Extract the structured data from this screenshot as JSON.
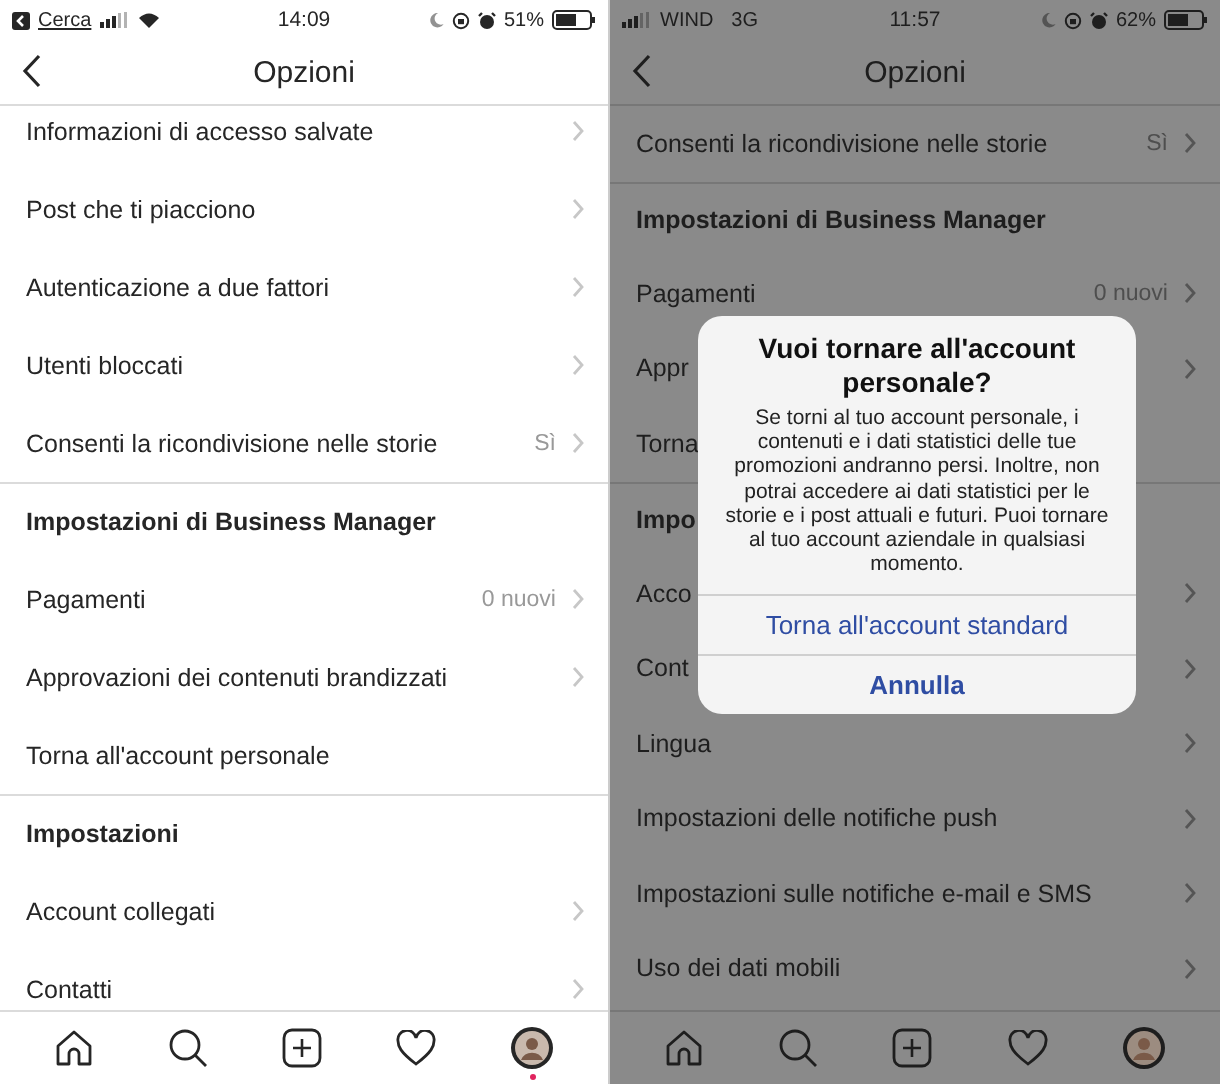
{
  "screens": [
    {
      "dimmed": false,
      "status_bar": {
        "back_link": "Cerca",
        "time": "14:09",
        "battery_text": "51%"
      },
      "nav": {
        "title": "Opzioni"
      },
      "rows": [
        {
          "kind": "item",
          "label": "Informazioni di accesso salvate",
          "chevron": true
        },
        {
          "kind": "item",
          "label": "Post che ti piacciono",
          "chevron": true
        },
        {
          "kind": "item",
          "label": "Autenticazione a due fattori",
          "chevron": true
        },
        {
          "kind": "item",
          "label": "Utenti bloccati",
          "chevron": true
        },
        {
          "kind": "item",
          "label": "Consenti la ricondivisione nelle storie",
          "value": "Sì",
          "chevron": true
        },
        {
          "kind": "header",
          "label": "Impostazioni di Business Manager"
        },
        {
          "kind": "item",
          "label": "Pagamenti",
          "value": "0 nuovi",
          "chevron": true
        },
        {
          "kind": "item",
          "label": "Approvazioni dei contenuti brandizzati",
          "chevron": true
        },
        {
          "kind": "item",
          "label": "Torna all'account personale",
          "chevron": false
        },
        {
          "kind": "header",
          "label": "Impostazioni"
        },
        {
          "kind": "item",
          "label": "Account collegati",
          "chevron": true
        },
        {
          "kind": "item",
          "label": "Contatti",
          "chevron": true
        }
      ],
      "tab_bar": {
        "items": [
          {
            "kind": "home"
          },
          {
            "kind": "search"
          },
          {
            "kind": "add"
          },
          {
            "kind": "heart"
          },
          {
            "kind": "profile",
            "notification": true
          }
        ]
      }
    },
    {
      "dimmed": true,
      "status_bar": {
        "carrier": "WIND",
        "network": "3G",
        "time": "11:57",
        "battery_text": "62%"
      },
      "nav": {
        "title": "Opzioni"
      },
      "rows": [
        {
          "kind": "item",
          "label": "Consenti la ricondivisione nelle storie",
          "value": "Sì",
          "chevron": true
        },
        {
          "kind": "header",
          "label": "Impostazioni di Business Manager"
        },
        {
          "kind": "item",
          "label": "Pagamenti",
          "value": "0 nuovi",
          "chevron": true
        },
        {
          "kind": "item",
          "label": "Appr",
          "chevron": true
        },
        {
          "kind": "item",
          "label": "Torna",
          "chevron": false
        },
        {
          "kind": "header",
          "label": "Impo"
        },
        {
          "kind": "item",
          "label": "Acco",
          "chevron": true
        },
        {
          "kind": "item",
          "label": "Cont",
          "chevron": true
        },
        {
          "kind": "item",
          "label": "Lingua",
          "chevron": true
        },
        {
          "kind": "item",
          "label": "Impostazioni delle notifiche push",
          "chevron": true
        },
        {
          "kind": "item",
          "label": "Impostazioni sulle notifiche e-mail e SMS",
          "chevron": true
        },
        {
          "kind": "item",
          "label": "Uso dei dati mobili",
          "chevron": true
        }
      ],
      "tab_bar": {
        "items": [
          {
            "kind": "home"
          },
          {
            "kind": "search"
          },
          {
            "kind": "add"
          },
          {
            "kind": "heart"
          },
          {
            "kind": "profile",
            "notification": false
          }
        ]
      },
      "dialog": {
        "title": "Vuoi tornare all'account personale?",
        "message": "Se torni al tuo account personale, i contenuti e i dati statistici delle tue promozioni andranno persi. Inoltre, non potrai accedere ai dati statistici per le storie e i post attuali e futuri. Puoi tornare al tuo account aziendale in qualsiasi momento.",
        "actions": [
          {
            "label": "Torna all'account standard",
            "kind": "default"
          },
          {
            "label": "Annulla",
            "kind": "cancel"
          }
        ]
      }
    }
  ]
}
